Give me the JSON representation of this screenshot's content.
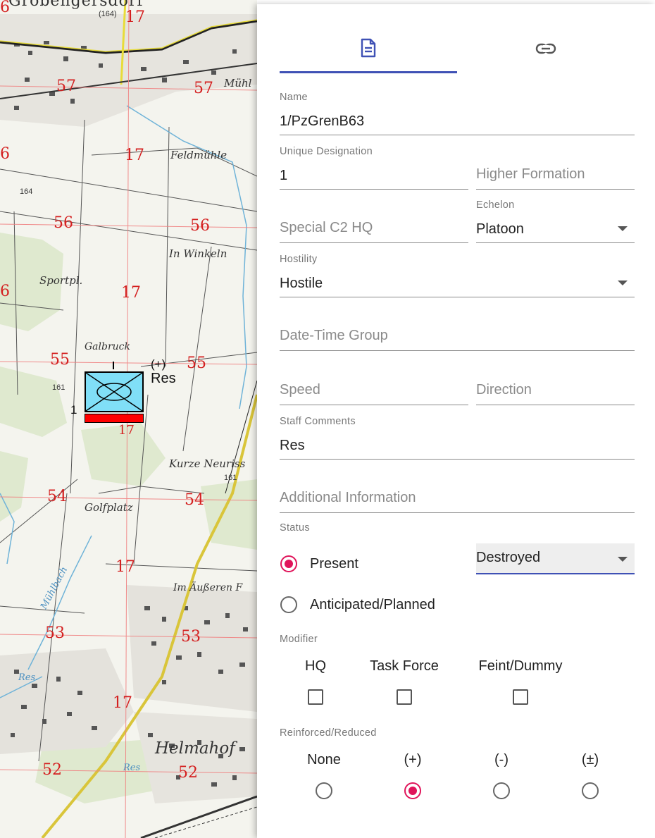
{
  "map": {
    "place_labels": {
      "town_top": "Grobengersdorf",
      "spot_164_top": "(164)",
      "muhl": "Mühl",
      "feldmuhle": "Feldmühle",
      "spot_164": "164",
      "in_winkeln": "In Winkeln",
      "sportpl": "Sportpl.",
      "galbruck": "Galbruck",
      "spot_161_left": "161",
      "kurze_neuriss": "Kurze Neuriss",
      "spot_161_right": "161",
      "golfplatz": "Golfplatz",
      "im_ausseren": "Im Äußeren F",
      "muhlbach": "Mühlbach",
      "res_water": "Res.",
      "res_water2": "Res",
      "helmahof": "Helmahof"
    },
    "grid_numbers": {
      "n57a": "57",
      "n57b": "57",
      "n17a": "17",
      "n17b": "17",
      "n56a": "56",
      "n56b": "56",
      "n17c": "17",
      "n55a": "55",
      "n55b": "55",
      "n17d": "17",
      "n54a": "54",
      "n54b": "54",
      "n17e": "17",
      "n53a": "53",
      "n53b": "53",
      "n17f": "17",
      "n52a": "52",
      "n52b": "52",
      "n6a": "6",
      "n6b": "6",
      "n6c": "6"
    },
    "unit_symbol": {
      "echelon": "I",
      "reinforced": "(+)",
      "comment": "Res",
      "designation": "1",
      "fill_color": "#80dff7",
      "status_bar_color": "#ff0000"
    }
  },
  "panel": {
    "tabs": [
      {
        "icon": "document-icon",
        "active": true
      },
      {
        "icon": "link-icon",
        "active": false
      }
    ],
    "name": {
      "label": "Name",
      "value": "1/PzGrenB63"
    },
    "unique_designation": {
      "label": "Unique Designation",
      "value": "1"
    },
    "higher_formation": {
      "placeholder": "Higher Formation"
    },
    "special_c2_hq": {
      "placeholder": "Special C2 HQ"
    },
    "echelon": {
      "label": "Echelon",
      "value": "Platoon"
    },
    "hostility": {
      "label": "Hostility",
      "value": "Hostile"
    },
    "date_time_group": {
      "placeholder": "Date-Time Group"
    },
    "speed": {
      "placeholder": "Speed"
    },
    "direction": {
      "placeholder": "Direction"
    },
    "staff_comments": {
      "label": "Staff Comments",
      "value": "Res"
    },
    "additional_information": {
      "placeholder": "Additional Information"
    },
    "status": {
      "label": "Status",
      "options": [
        {
          "label": "Present",
          "checked": true
        },
        {
          "label": "Anticipated/Planned",
          "checked": false
        }
      ],
      "condition": "Destroyed"
    },
    "modifier": {
      "label": "Modifier",
      "options": [
        {
          "label": "HQ",
          "checked": false
        },
        {
          "label": "Task Force",
          "checked": false
        },
        {
          "label": "Feint/Dummy",
          "checked": false
        }
      ]
    },
    "reinforced_reduced": {
      "label": "Reinforced/Reduced",
      "options": [
        {
          "label": "None",
          "checked": false
        },
        {
          "label": "(+)",
          "checked": true
        },
        {
          "label": "(-)",
          "checked": false
        },
        {
          "label": "(±)",
          "checked": false
        }
      ]
    },
    "colors": {
      "accent": "#3f51b5",
      "radio_selected": "#e0145a"
    }
  }
}
